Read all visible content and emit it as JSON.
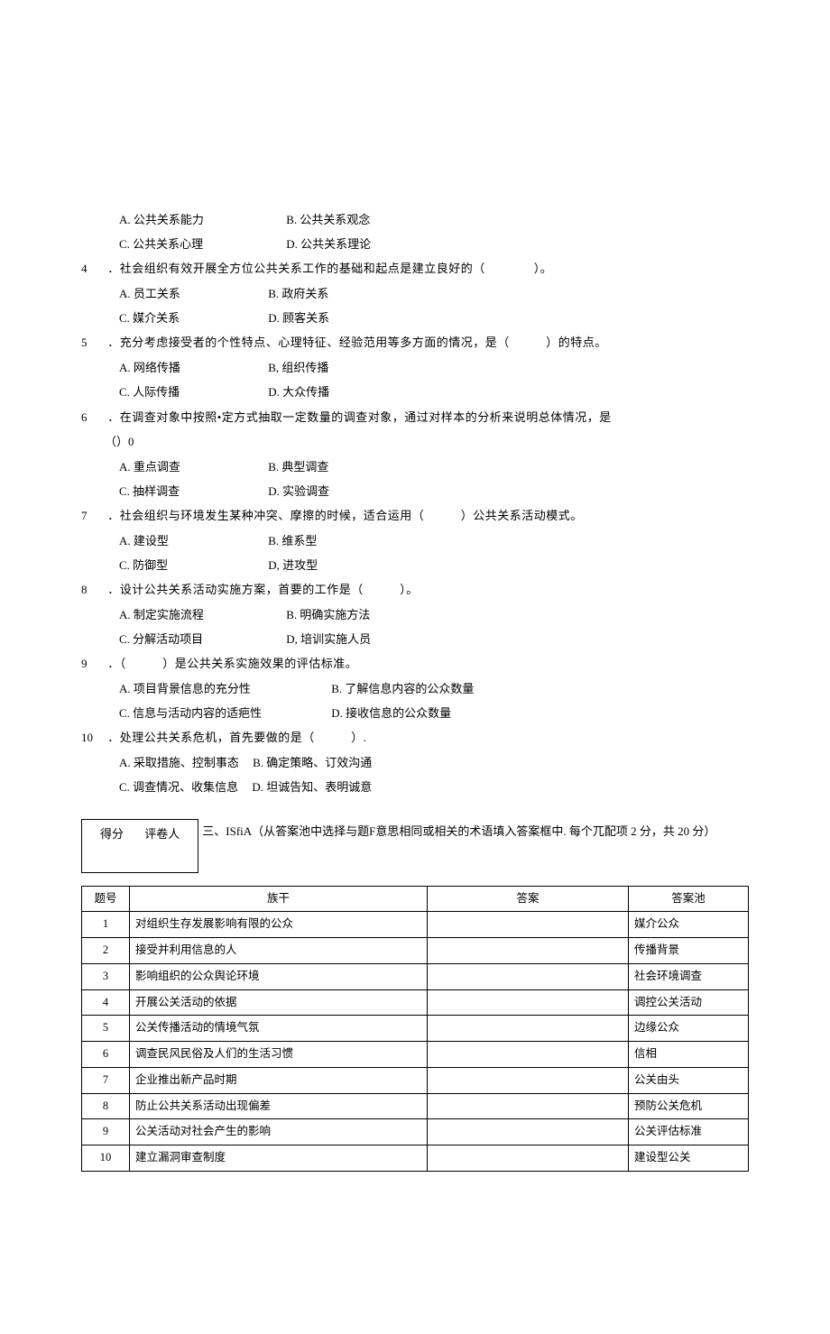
{
  "q3": {
    "optA": "A. 公共关系能力",
    "optB": "B. 公共关系观念",
    "optC": "C. 公共关系心理",
    "optD": "D. 公共关系理论"
  },
  "q4": {
    "num": "4",
    "stem": "．社会组织有效开展全方位公共关系工作的基础和起点是建立良好的（　　　　）。",
    "optA": "A. 员工关系",
    "optB": "B. 政府关系",
    "optC": "C. 媒介关系",
    "optD": "D. 顾客关系"
  },
  "q5": {
    "num": "5",
    "stem": "．充分考虑接受者的个性特点、心理特征、经验范用等多方面的情况，是（　　　）的特点。",
    "optA": "A. 网络传播",
    "optB": "B, 组织传播",
    "optC": "C. 人际传播",
    "optD": "D. 大众传播"
  },
  "q6": {
    "num": "6",
    "stem": "．在调查对象中按照•定方式抽取一定数量的调查对象，通过对样本的分析来说明总体情况，是",
    "stem2": "（）0",
    "optA": "A. 重点调查",
    "optB": "B. 典型调查",
    "optC": "C. 抽样调查",
    "optD": "D. 实验调查"
  },
  "q7": {
    "num": "7",
    "stem": "．社会组织与环境发生某种冲突、摩擦的时候，适合运用（　　　）公共关系活动模式。",
    "optA": "A. 建设型",
    "optB": "B. 维系型",
    "optC": "C. 防御型",
    "optD": "D, 进攻型"
  },
  "q8": {
    "num": "8",
    "stem": "．设计公共关系活动实施方案，首要的工作是（　　　）。",
    "optA": "A. 制定实施流程",
    "optB": "B. 明确实施方法",
    "optC": "C. 分解活动项目",
    "optD": "D, 培训实施人员"
  },
  "q9": {
    "num": "9",
    "stem": "．（　　　）是公共关系实施效果的评估标准。",
    "optA": "A. 项目背景信息的充分性",
    "optB": "B. 了解信息内容的公众数量",
    "optC": "C. 信息与活动内容的适疤性",
    "optD": "D. 接收信息的公众数量"
  },
  "q10": {
    "num": "10",
    "stem": "．处理公共关系危机，首先要做的是（　　　）.",
    "optA": "A. 采取措施、控制事态",
    "optB": "B. 确定策略、订效沟通",
    "optC": "C. 调查情况、收集信息",
    "optD": "D. 坦诚告知、表明诚意"
  },
  "scorebox": {
    "score": "得分",
    "grader": "评卷人"
  },
  "section3": "三、ISfiA（从答案池中选择与题F意思相同或相关的术语填入答案框中. 每个兀配项 2 分，共 20 分）",
  "table": {
    "h1": "题号",
    "h2": "族干",
    "h3": "答案",
    "h4": "答案池",
    "rows": [
      {
        "n": "1",
        "stem": "对组织生存发展影响有限的公众",
        "pool": "媒介公众"
      },
      {
        "n": "2",
        "stem": "接受并利用信息的人",
        "pool": "传播背景"
      },
      {
        "n": "3",
        "stem": "影响组织的公众舆论环境",
        "pool": "社会环境调查"
      },
      {
        "n": "4",
        "stem": "开展公关活动的依据",
        "pool": "调控公关活动"
      },
      {
        "n": "5",
        "stem": "公关传播活动的情境气氛",
        "pool": "边缘公众"
      },
      {
        "n": "6",
        "stem": "调查民风民俗及人们的生活习惯",
        "pool": "信相"
      },
      {
        "n": "7",
        "stem": "企业推出新产品时期",
        "pool": "公关由头"
      },
      {
        "n": "8",
        "stem": "防止公共关系活动出现偏差",
        "pool": "预防公关危机"
      },
      {
        "n": "9",
        "stem": "公关活动对社会产生的影响",
        "pool": "公关评估标准"
      },
      {
        "n": "10",
        "stem": "建立漏洞审查制度",
        "pool": "建设型公关"
      }
    ]
  }
}
